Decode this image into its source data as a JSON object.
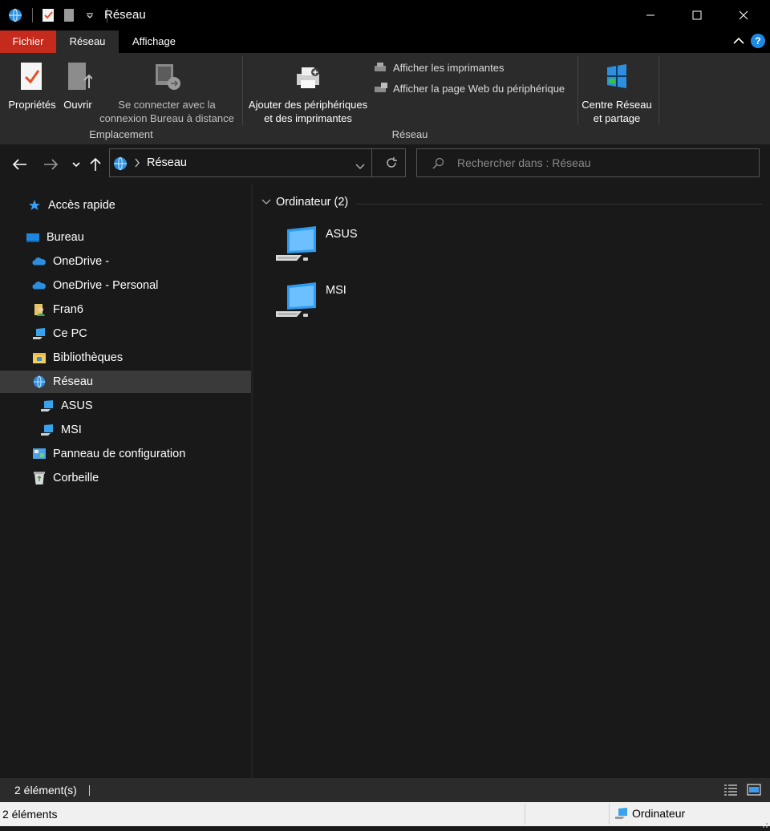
{
  "window": {
    "title": "Réseau"
  },
  "ribbon_tabs": {
    "file": "Fichier",
    "network": "Réseau",
    "view": "Affichage"
  },
  "ribbon": {
    "properties": "Propriétés",
    "open": "Ouvrir",
    "remote_line1": "Se connecter avec la",
    "remote_line2": "connexion Bureau à distance",
    "group_location": "Emplacement",
    "add_devices_line1": "Ajouter des périphériques",
    "add_devices_line2": "et des imprimantes",
    "show_printers": "Afficher les imprimantes",
    "show_device_web": "Afficher la page Web du périphérique",
    "group_network": "Réseau",
    "network_center_line1": "Centre Réseau",
    "network_center_line2": "et partage"
  },
  "address": {
    "path": "Réseau",
    "search_placeholder": "Rechercher dans : Réseau"
  },
  "sidebar": {
    "quick_access": "Accès rapide",
    "desktop": "Bureau",
    "onedrive": "OneDrive -",
    "onedrive_personal": "OneDrive - Personal",
    "user": "Fran6",
    "this_pc": "Ce PC",
    "libraries": "Bibliothèques",
    "network": "Réseau",
    "asus": "ASUS",
    "msi": "MSI",
    "control_panel": "Panneau de configuration",
    "recycle_bin": "Corbeille"
  },
  "content": {
    "group_header": "Ordinateur (2)",
    "items": [
      {
        "label": "ASUS"
      },
      {
        "label": "MSI"
      }
    ]
  },
  "status": {
    "count": "2 élément(s)",
    "bottom_count": "2 éléments",
    "zone": "Ordinateur"
  },
  "colors": {
    "accent_file_tab": "#c42b1c",
    "selection": "#3a3a3a",
    "help": "#1e88e5"
  }
}
